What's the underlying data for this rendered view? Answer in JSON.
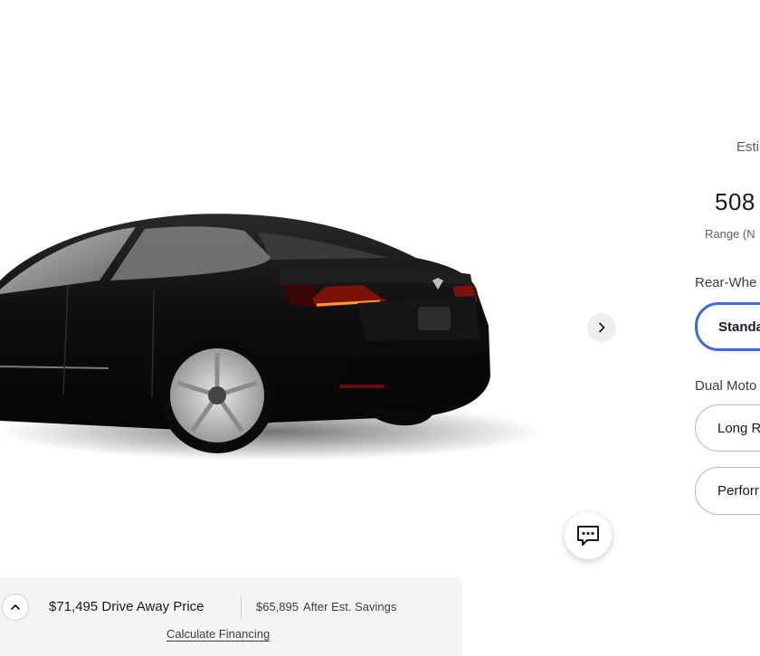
{
  "range": {
    "estimate_label": "Esti",
    "value": "508",
    "caption": "Range (N"
  },
  "groups": {
    "rear_wheel_title": "Rear-Whe",
    "dual_motor_title": "Dual Moto"
  },
  "options": [
    {
      "label": "Standa",
      "selected": true
    },
    {
      "label": "Long R",
      "selected": false
    },
    {
      "label": "Perforr",
      "selected": false
    }
  ],
  "price_bar": {
    "amount": "$71,495",
    "amount_label": "Drive Away Price",
    "savings_amount": "$65,895",
    "savings_label": "After Est. Savings",
    "financing_link": "Calculate Financing"
  },
  "icons": {
    "next": "chevron-right-icon",
    "chat": "chat-bubble-icon",
    "collapse": "chevron-up-icon"
  },
  "colors": {
    "accent": "#3e6ae1",
    "car_body": "#0c0c0c",
    "bar_bg": "#f4f4f4"
  }
}
